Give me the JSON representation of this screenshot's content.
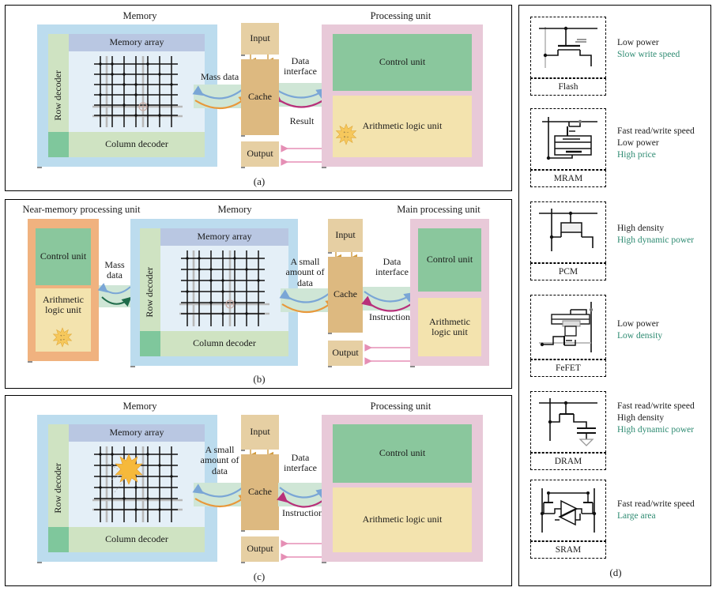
{
  "figure": {
    "panels": [
      "(a)",
      "(b)",
      "(c)",
      "(d)"
    ]
  },
  "panel_a": {
    "caption": "(a)",
    "memory_title": "Memory",
    "processing_title": "Processing unit",
    "memory_array": "Memory array",
    "row_decoder": "Row decoder",
    "column_decoder": "Column decoder",
    "cache": "Cache",
    "input": "Input",
    "output": "Output",
    "control_unit": "Control unit",
    "alu": "Arithmetic logic unit",
    "bus_left_label": "Mass data",
    "bus_right_label": "Data\ninterface",
    "result_label": "Result"
  },
  "panel_b": {
    "caption": "(b)",
    "nmp_title": "Near-memory processing unit",
    "memory_title": "Memory",
    "main_title": "Main processing unit",
    "memory_array": "Memory array",
    "row_decoder": "Row decoder",
    "column_decoder": "Column decoder",
    "cache": "Cache",
    "input": "Input",
    "output": "Output",
    "control_unit": "Control unit",
    "alu": "Arithmetic\nlogic unit",
    "control_unit_main": "Control unit",
    "alu_main": "Arithmetic\nlogic unit",
    "mass_data": "Mass\ndata",
    "small_data": "A small\namount of\ndata",
    "data_interface": "Data\ninterface",
    "instruction": "Instruction"
  },
  "panel_c": {
    "caption": "(c)",
    "memory_title": "Memory",
    "processing_title": "Processing unit",
    "memory_array": "Memory array",
    "row_decoder": "Row decoder",
    "column_decoder": "Column decoder",
    "cache": "Cache",
    "input": "Input",
    "output": "Output",
    "control_unit": "Control unit",
    "alu": "Arithmetic logic unit",
    "small_data": "A small\namount of\ndata",
    "data_interface": "Data\ninterface",
    "instruction": "Instruction"
  },
  "panel_d": {
    "caption": "(d)",
    "cells": [
      {
        "name": "Flash",
        "icon": "flash-transistor-icon",
        "specs": [
          {
            "text": "Low power",
            "color": "#1a1a1a"
          },
          {
            "text": "Slow write speed",
            "color": "#2e8b72"
          }
        ]
      },
      {
        "name": "MRAM",
        "icon": "mram-mtj-icon",
        "specs": [
          {
            "text": "Fast read/write speed",
            "color": "#1a1a1a"
          },
          {
            "text": "Low power",
            "color": "#1a1a1a"
          },
          {
            "text": "High price",
            "color": "#2e8b72"
          }
        ]
      },
      {
        "name": "PCM",
        "icon": "pcm-resistor-icon",
        "specs": [
          {
            "text": "High density",
            "color": "#1a1a1a"
          },
          {
            "text": "High dynamic power",
            "color": "#2e8b72"
          }
        ]
      },
      {
        "name": "FeFET",
        "icon": "fefet-icon",
        "specs": [
          {
            "text": "Low power",
            "color": "#1a1a1a"
          },
          {
            "text": "Low density",
            "color": "#2e8b72"
          }
        ]
      },
      {
        "name": "DRAM",
        "icon": "dram-1t1c-icon",
        "specs": [
          {
            "text": "Fast read/write speed",
            "color": "#1a1a1a"
          },
          {
            "text": "High density",
            "color": "#1a1a1a"
          },
          {
            "text": "High dynamic power",
            "color": "#2e8b72"
          }
        ]
      },
      {
        "name": "SRAM",
        "icon": "sram-6t-icon",
        "specs": [
          {
            "text": "Fast read/write speed",
            "color": "#1a1a1a"
          },
          {
            "text": "Large area",
            "color": "#2e8b72"
          }
        ]
      }
    ]
  },
  "colors": {
    "memory_outer": "#bcdcee",
    "memory_array_header": "#b9c7e2",
    "memory_array_body": "#e4eff7",
    "row_decoder": "#cfe3c2",
    "column_decoder": "#cfe3c2",
    "column_decoder_corner": "#7fc79c",
    "processing_outer": "#e8c9d8",
    "control_unit": "#8ac79d",
    "alu": "#f3e3ae",
    "cache": "#ddb980",
    "input_output": "#e6cfa3",
    "near_memory_outer": "#f0b27f",
    "bus_band": "#cfe6d6",
    "arrow_blue": "#7aa6d6",
    "arrow_orange": "#e8983a",
    "arrow_magenta": "#b8307a",
    "arrow_green": "#1f6b4a",
    "arrow_pink": "#e58fb5",
    "spec_green": "#2e8b72"
  }
}
